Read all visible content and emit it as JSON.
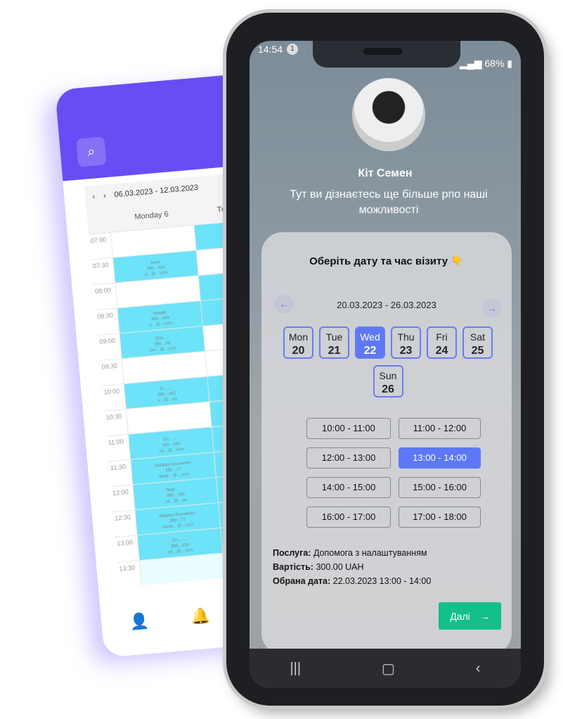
{
  "back_app": {
    "search_icon": "search-icon",
    "week_range": "06.03.2023 - 12.03.2023",
    "days": [
      "Monday 6",
      "Tuesday 7"
    ],
    "times": [
      "07:00",
      "07:30",
      "08:00",
      "08:30",
      "09:00",
      "09:30",
      "10:00",
      "10:30",
      "11:00",
      "11:30",
      "12:00",
      "12:30",
      "13:00",
      "13:30"
    ],
    "monday_busy": [
      false,
      true,
      false,
      true,
      true,
      false,
      true,
      false,
      true,
      true,
      true,
      true,
      true,
      false
    ],
    "tuesday_busy": [
      true,
      false,
      true,
      true,
      false,
      false,
      true,
      true,
      true,
      true,
      true,
      true,
      true,
      false
    ],
    "monday_entries": [
      "",
      "Анна\n380…434\nd…@…com",
      "",
      "Андрій\n380…434\na…@…com",
      "Оля …\n380…08\nDol…@…com",
      "",
      "G… …\n380…457\ns…@…ua",
      "",
      "Ол… …\n380…434\nsd…@…com",
      "Nataliya Kovalenko\n380…77\nnkole…@…com",
      "Step… …\n380…788\nsd…@…ua",
      "Nataliya Kovalenko\n380…77\nnkole…@…com",
      "Ол… …\n380…434\nsd…@…com",
      ""
    ]
  },
  "phone": {
    "status": {
      "time": "14:54",
      "notif_count": "1",
      "battery": "68%"
    },
    "profile": {
      "name": "Кіт Семен",
      "subtitle": "Тут ви дізнаєтесь ще більше рпо наші можливості"
    },
    "booking": {
      "title": "Оберіть дату та час візиту 👇",
      "week_range": "20.03.2023 - 26.03.2023",
      "days": [
        {
          "d": "Mon",
          "n": "20"
        },
        {
          "d": "Tue",
          "n": "21"
        },
        {
          "d": "Wed",
          "n": "22",
          "selected": true
        },
        {
          "d": "Thu",
          "n": "23"
        },
        {
          "d": "Fri",
          "n": "24"
        },
        {
          "d": "Sat",
          "n": "25"
        },
        {
          "d": "Sun",
          "n": "26"
        }
      ],
      "slots": [
        "10:00 - 11:00",
        "11:00 - 12:00",
        "12:00 - 13:00",
        "13:00 - 14:00",
        "14:00 - 15:00",
        "15:00 - 16:00",
        "16:00 - 17:00",
        "17:00 - 18:00"
      ],
      "selected_slot": "13:00 - 14:00",
      "service_label": "Послуга:",
      "service": "Допомога з налаштуванням",
      "price_label": "Вартість:",
      "price": "300.00 UAH",
      "date_label": "Обрана дата:",
      "date": "22.03.2023 13:00 - 14:00",
      "next_label": "Далі"
    },
    "accent": "#5d78f5",
    "next_color": "#13bf8a"
  }
}
